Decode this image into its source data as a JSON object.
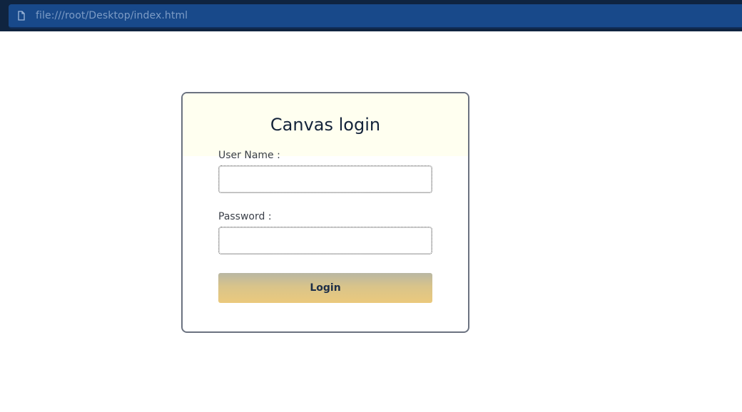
{
  "browser": {
    "url": "file:///root/Desktop/index.html",
    "icon": "page-icon"
  },
  "login_card": {
    "title": "Canvas login",
    "username_label": "User Name :",
    "username_value": "",
    "password_label": "Password :",
    "password_value": "",
    "login_button": "Login"
  },
  "colors": {
    "topbar": "#0f2440",
    "urlbar": "#18498a",
    "card_header": "#fffff0",
    "card_border": "#6b7280",
    "button_top": "#b9b7a3",
    "button_bottom": "#ebc97d"
  }
}
